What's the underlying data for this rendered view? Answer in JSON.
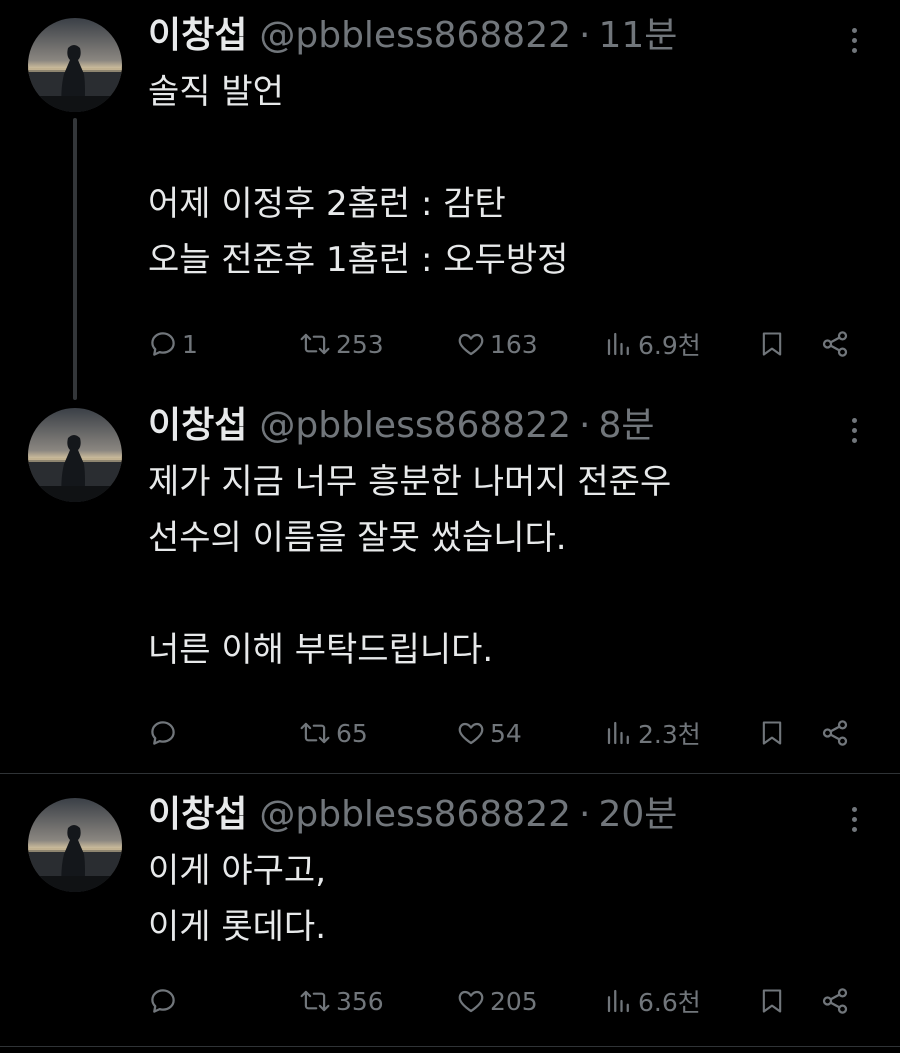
{
  "accent": {
    "background": "#000000",
    "text": "#e7e9ea",
    "muted": "#71767b",
    "divider": "#2f3336"
  },
  "tweets": [
    {
      "name": "이창섭",
      "handle": "@pbbless868822",
      "separator": "·",
      "time": "11분",
      "lines": [
        "솔직 발언",
        "",
        "어제 이정후 2홈런 : 감탄",
        "오늘 전준후 1홈런 : 오두방정"
      ],
      "replies": "1",
      "retweets": "253",
      "likes": "163",
      "views": "6.9천"
    },
    {
      "name": "이창섭",
      "handle": "@pbbless868822",
      "separator": "·",
      "time": "8분",
      "lines": [
        "제가 지금 너무 흥분한 나머지 전준우",
        "선수의 이름을 잘못 썼습니다.",
        "",
        "너른 이해 부탁드립니다."
      ],
      "replies": "",
      "retweets": "65",
      "likes": "54",
      "views": "2.3천"
    },
    {
      "name": "이창섭",
      "handle": "@pbbless868822",
      "separator": "·",
      "time": "20분",
      "lines": [
        "이게 야구고,",
        "이게 롯데다."
      ],
      "replies": "",
      "retweets": "356",
      "likes": "205",
      "views": "6.6천"
    }
  ],
  "icons": [
    "reply-icon",
    "retweet-icon",
    "like-icon",
    "views-icon",
    "bookmark-icon",
    "share-icon",
    "more-icon"
  ]
}
